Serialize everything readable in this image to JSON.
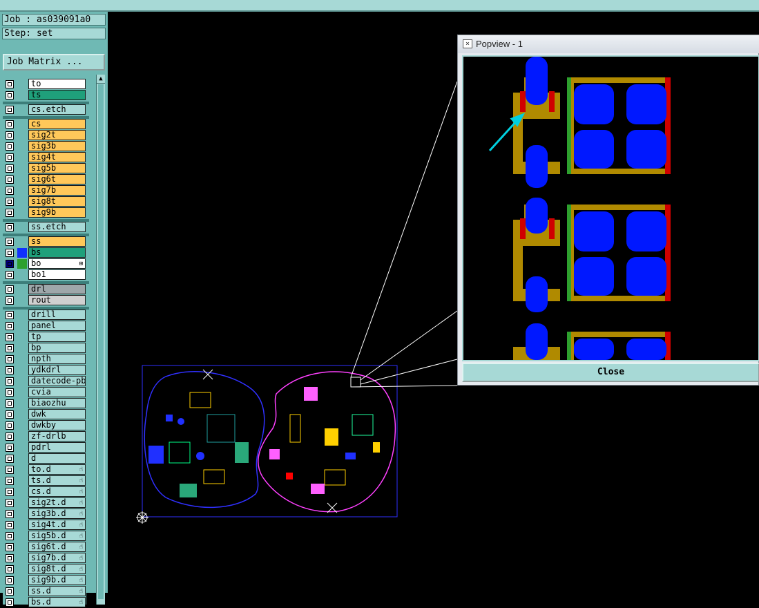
{
  "job": {
    "text": "Job : as039091a0"
  },
  "step": {
    "text": "Step: set"
  },
  "job_matrix_button": "Job Matrix ...",
  "layers": [
    {
      "name": "to",
      "color": "white"
    },
    {
      "name": "ts",
      "color": "green"
    },
    {
      "name": "cs.etch",
      "color": "teal"
    },
    {
      "name": "cs",
      "color": "orange"
    },
    {
      "name": "sig2t",
      "color": "orange"
    },
    {
      "name": "sig3b",
      "color": "orange"
    },
    {
      "name": "sig4t",
      "color": "orange"
    },
    {
      "name": "sig5b",
      "color": "orange"
    },
    {
      "name": "sig6t",
      "color": "orange"
    },
    {
      "name": "sig7b",
      "color": "orange"
    },
    {
      "name": "sig8t",
      "color": "orange"
    },
    {
      "name": "sig9b",
      "color": "orange"
    },
    {
      "name": "ss.etch",
      "color": "teal"
    },
    {
      "name": "ss",
      "color": "orange"
    },
    {
      "name": "bs",
      "color": "green"
    },
    {
      "name": "bo",
      "color": "white"
    },
    {
      "name": "bo1",
      "color": "white"
    },
    {
      "name": "drl",
      "color": "grey"
    },
    {
      "name": "rout",
      "color": "lgrey"
    },
    {
      "name": "drill",
      "color": "teal"
    },
    {
      "name": "panel",
      "color": "teal"
    },
    {
      "name": "tp",
      "color": "teal"
    },
    {
      "name": "bp",
      "color": "teal"
    },
    {
      "name": "npth",
      "color": "teal"
    },
    {
      "name": "ydkdrl",
      "color": "teal"
    },
    {
      "name": "datecode-pbc",
      "color": "teal"
    },
    {
      "name": "cvia",
      "color": "teal"
    },
    {
      "name": "biaozhu",
      "color": "teal"
    },
    {
      "name": "dwk",
      "color": "teal"
    },
    {
      "name": "dwkby",
      "color": "teal"
    },
    {
      "name": "zf-drlb",
      "color": "teal"
    },
    {
      "name": "pdrl",
      "color": "teal"
    },
    {
      "name": "d",
      "color": "teal"
    },
    {
      "name": "to.d",
      "color": "teal"
    },
    {
      "name": "ts.d",
      "color": "teal"
    },
    {
      "name": "cs.d",
      "color": "teal"
    },
    {
      "name": "sig2t.d",
      "color": "teal"
    },
    {
      "name": "sig3b.d",
      "color": "teal"
    },
    {
      "name": "sig4t.d",
      "color": "teal"
    },
    {
      "name": "sig5b.d",
      "color": "teal"
    },
    {
      "name": "sig6t.d",
      "color": "teal"
    },
    {
      "name": "sig7b.d",
      "color": "teal"
    },
    {
      "name": "sig8t.d",
      "color": "teal"
    },
    {
      "name": "sig9b.d",
      "color": "teal"
    },
    {
      "name": "ss.d",
      "color": "teal"
    },
    {
      "name": "bs.d",
      "color": "teal"
    }
  ],
  "popview": {
    "title": "Popview - 1",
    "close_label": "Close"
  },
  "colors": {
    "accent": "#a7d9d6",
    "sidebar": "#6fb9b4",
    "canvas": "#000000",
    "copper": "#b08a00",
    "pad": "#0000ff",
    "cursor_arrow": "#00d0e0"
  }
}
